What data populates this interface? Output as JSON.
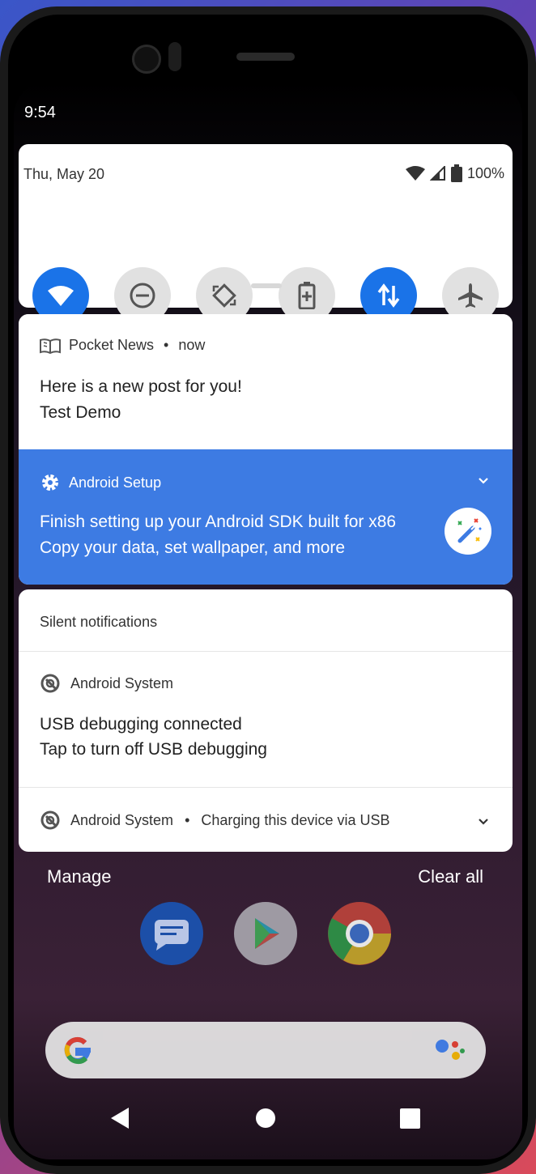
{
  "status_bar": {
    "time": "9:54"
  },
  "quick_settings": {
    "date": "Thu, May 20",
    "battery": "100%",
    "tiles": [
      {
        "name": "wifi",
        "on": true
      },
      {
        "name": "do-not-disturb",
        "on": false
      },
      {
        "name": "auto-rotate",
        "on": false
      },
      {
        "name": "battery-saver",
        "on": false
      },
      {
        "name": "mobile-data",
        "on": true
      },
      {
        "name": "airplane-mode",
        "on": false
      }
    ]
  },
  "notifications": {
    "pocket": {
      "app": "Pocket News",
      "time": "now",
      "title": "Here is a new post for you!",
      "text": "Test Demo"
    },
    "setup": {
      "app": "Android Setup",
      "title": "Finish setting up your Android SDK built for x86",
      "text": "Copy your data, set wallpaper, and more"
    }
  },
  "silent": {
    "label": "Silent notifications",
    "usb": {
      "app": "Android System",
      "title": "USB debugging connected",
      "text": "Tap to turn off USB debugging"
    },
    "charging": {
      "app": "Android System",
      "text": "Charging this device via USB"
    }
  },
  "footer": {
    "manage": "Manage",
    "clear_all": "Clear all"
  },
  "colors": {
    "accent": "#1a73e8",
    "setup_bg": "#3d7be3"
  }
}
